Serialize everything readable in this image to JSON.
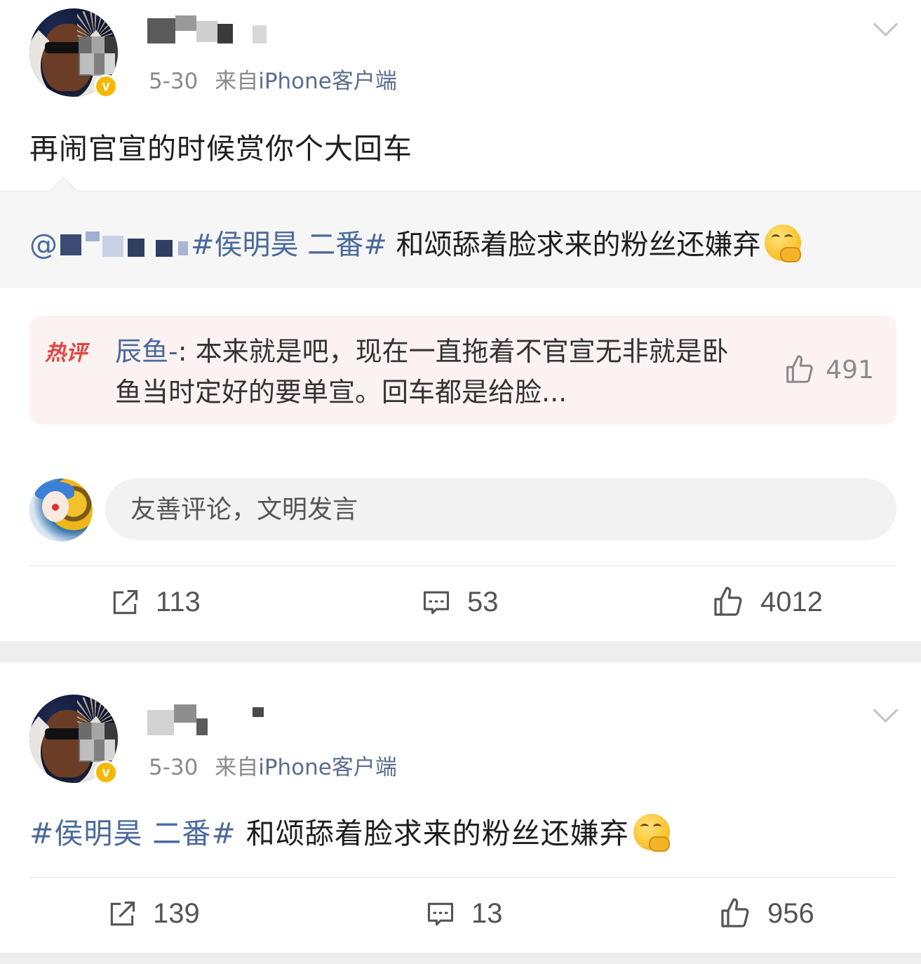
{
  "post1": {
    "meta_date": "5-30",
    "meta_from": "来自",
    "meta_source": "iPhone客户端",
    "text": "再闹官宣的时候赏你个大回车",
    "repost": {
      "prefix": "@",
      "topic": "#侯明昊 二番#",
      "text": " 和颂舔着脸求来的粉丝还嫌弃"
    },
    "hot_comment": {
      "tag": "热评",
      "author": "辰鱼-",
      "text": ": 本来就是吧，现在一直拖着不官宣无非就是卧鱼当时定好的要单宣。回车都是给脸...",
      "likes": "491"
    },
    "comment_input": {
      "placeholder": "友善评论，文明发言"
    },
    "stats": {
      "reposts": "113",
      "comments": "53",
      "likes": "4012"
    }
  },
  "post2": {
    "meta_date": "5-30",
    "meta_from": "来自",
    "meta_source": "iPhone客户端",
    "topic": "#侯明昊 二番#",
    "text": " 和颂舔着脸求来的粉丝还嫌弃",
    "stats": {
      "reposts": "139",
      "comments": "13",
      "likes": "956"
    }
  },
  "colors": {
    "link": "#4a6a9b",
    "hot_tag": "#e2443e",
    "verified_badge": "#f5b800"
  }
}
